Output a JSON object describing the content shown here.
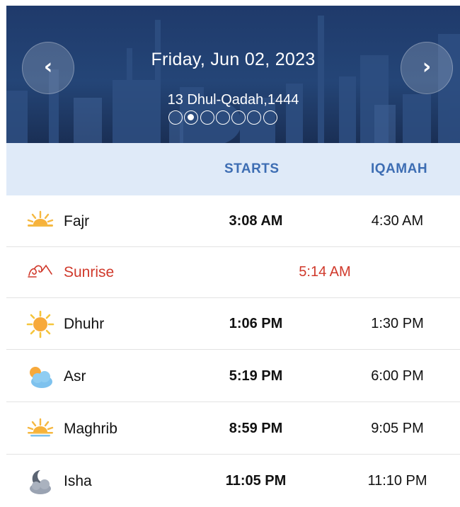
{
  "header": {
    "date": "Friday, Jun 02, 2023",
    "hijri_date": "13 Dhul-Qadah,1444",
    "prev_symbol": "‹",
    "next_symbol": "›",
    "page_count": 7,
    "active_page": 2
  },
  "columns": {
    "starts": "STARTS",
    "iqamah": "IQAMAH"
  },
  "prayers": [
    {
      "name": "Fajr",
      "starts": "3:08 AM",
      "iqamah": "4:30 AM",
      "icon": "dawn-icon"
    },
    {
      "name": "Sunrise",
      "starts": "5:14 AM",
      "iqamah": "",
      "icon": "sunrise-icon"
    },
    {
      "name": "Dhuhr",
      "starts": "1:06 PM",
      "iqamah": "1:30 PM",
      "icon": "sun-icon"
    },
    {
      "name": "Asr",
      "starts": "5:19 PM",
      "iqamah": "6:00 PM",
      "icon": "sun-cloud-icon"
    },
    {
      "name": "Maghrib",
      "starts": "8:59 PM",
      "iqamah": "9:05 PM",
      "icon": "sunset-icon"
    },
    {
      "name": "Isha",
      "starts": "11:05 PM",
      "iqamah": "11:10 PM",
      "icon": "moon-cloud-icon"
    }
  ],
  "colors": {
    "header_bg": "#22406f",
    "column_header_bg": "#dfeaf8",
    "column_header_text": "#3d6db3",
    "sunrise_text": "#d0392b"
  }
}
